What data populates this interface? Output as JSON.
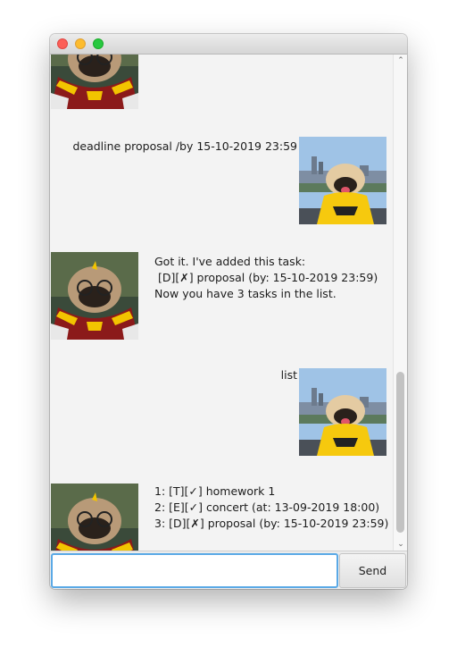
{
  "dialog": {
    "items": [
      {
        "sender": "bot",
        "text": ""
      },
      {
        "sender": "user",
        "text": "deadline proposal /by 15-10-2019 23:59"
      },
      {
        "sender": "bot",
        "text": "Got it. I've added this task:\n [D][✗] proposal (by: 15-10-2019 23:59)\nNow you have 3 tasks in the list."
      },
      {
        "sender": "user",
        "text": "list"
      },
      {
        "sender": "bot",
        "text": "1: [T][✓] homework 1\n2: [E][✓] concert (at: 13-09-2019 18:00)\n3: [D][✗] proposal (by: 15-10-2019 23:59)"
      }
    ]
  },
  "input": {
    "value": "",
    "placeholder": ""
  },
  "send_button": {
    "label": "Send"
  },
  "colors": {
    "window_bg": "#f3f3f3",
    "input_focus_border": "#5aa9e6",
    "traffic_red": "#fc5f57",
    "traffic_yellow": "#fdbc2e",
    "traffic_green": "#28c840",
    "scarf_yellow": "#f2c400",
    "scarf_red": "#8b1a1a",
    "shirt_yellow": "#f6c90e"
  },
  "icons": {
    "bot_avatar": "pug-in-scarf-avatar",
    "user_avatar": "pug-in-city-avatar"
  }
}
